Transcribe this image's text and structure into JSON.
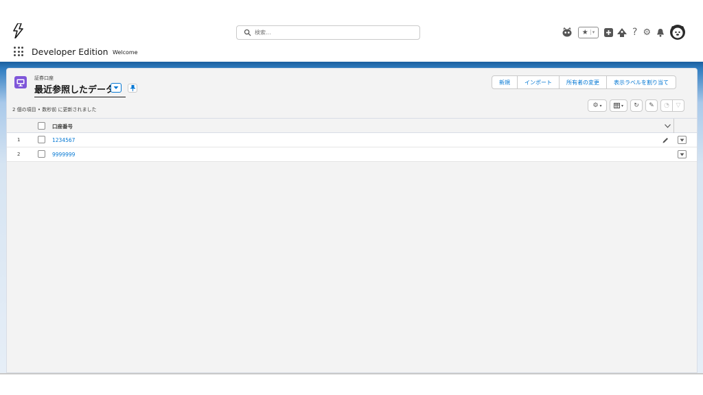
{
  "header": {
    "search_placeholder": "検索..."
  },
  "nav": {
    "app_name": "Developer Edition",
    "tab": "Welcome"
  },
  "list_view": {
    "object_label": "証券口座",
    "title": "最近参照したデータ",
    "status": "2 個の項目 • 数秒前 に更新されました",
    "actions": [
      "新規",
      "インポート",
      "所有者の変更",
      "表示ラベルを割り当て"
    ],
    "column_header": "口座番号",
    "rows": [
      {
        "num": "1",
        "account": "1234567"
      },
      {
        "num": "2",
        "account": "9999999"
      }
    ]
  },
  "colors": {
    "brand": "#0176d3",
    "object_icon": "#7f56d9",
    "header_band": "#1b5f9e"
  },
  "icons": [
    "lightning-logo-icon",
    "search-icon",
    "astro-icon",
    "favorites-icon",
    "global-actions-icon",
    "trailhead-icon",
    "help-icon",
    "setup-gear-icon",
    "notifications-bell-icon",
    "user-avatar-icon",
    "app-launcher-icon",
    "list-object-icon",
    "chevron-down-icon",
    "pin-icon",
    "list-settings-icon",
    "display-as-table-icon",
    "refresh-icon",
    "inline-edit-icon",
    "chart-icon",
    "filter-icon"
  ]
}
